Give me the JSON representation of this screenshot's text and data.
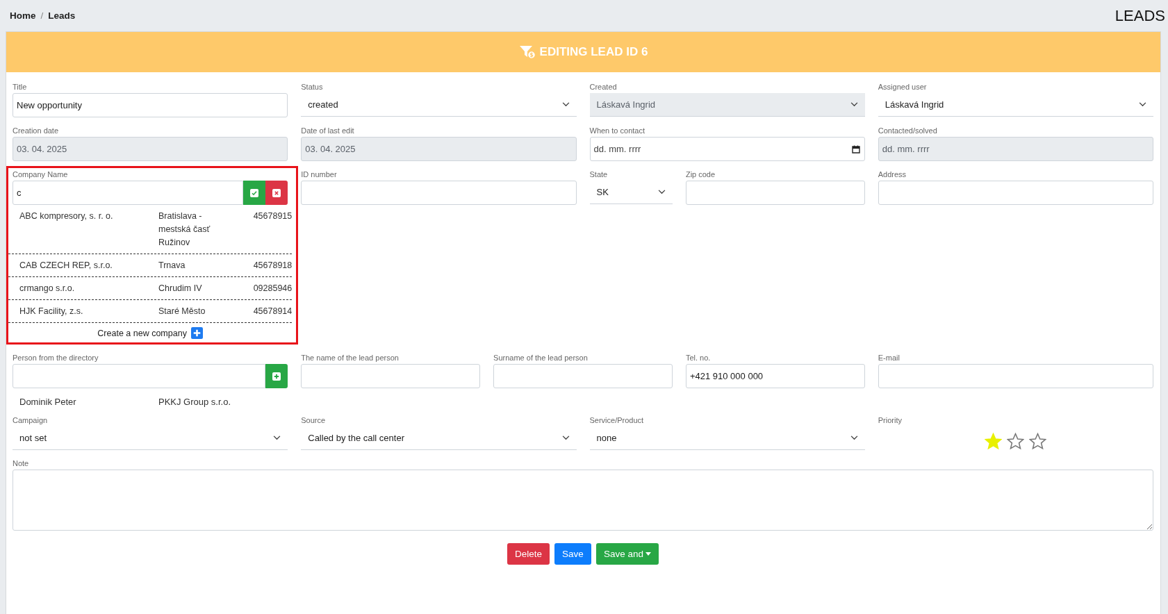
{
  "breadcrumb": {
    "items": [
      "Home",
      "Leads"
    ],
    "separator": "/"
  },
  "page_title": "LEADS",
  "header": {
    "title": "EDITING LEAD ID 6"
  },
  "rows": [
    {
      "fields": [
        {
          "label": "Title",
          "kind": "text",
          "value": "New opportunity",
          "disabled": false
        },
        {
          "label": "Status",
          "kind": "select",
          "value": "created",
          "disabled": false,
          "highlighted": false
        },
        {
          "label": "Created",
          "kind": "select",
          "value": "Láskavá Ingrid",
          "disabled": true,
          "highlighted": false
        },
        {
          "label": "Assigned user",
          "kind": "select",
          "value": "Láskavá Ingrid",
          "disabled": false,
          "highlighted": false
        }
      ]
    },
    {
      "fields": [
        {
          "label": "Creation date",
          "kind": "text",
          "value": "03. 04. 2025",
          "disabled": true,
          "highlighted": false
        },
        {
          "label": "Date of last edit",
          "kind": "text",
          "value": "03. 04. 2025",
          "disabled": true,
          "highlighted": false
        },
        {
          "label": "When to contact",
          "kind": "date",
          "placeholder": "dd. mm. rrrr",
          "disabled": false,
          "highlighted": false
        },
        {
          "label": "Contacted/solved",
          "kind": "text",
          "placeholder": "dd. mm. rrrr",
          "disabled": true,
          "highlighted": false
        }
      ]
    },
    {
      "fields": [
        {
          "label": "Company Name",
          "kind": "company_search",
          "value": "c",
          "disabled": false,
          "highlighted": true,
          "create_label": "Create a new company",
          "results": [
            {
              "name": "ABC kompresory, s. r. o.",
              "city": "Bratislava - mestská časť Ružinov",
              "id": "45678915"
            },
            {
              "name": "CAB CZECH REP, s.r.o.",
              "city": "Trnava",
              "id": "45678918"
            },
            {
              "name": "crmango s.r.o.",
              "city": "Chrudim IV",
              "id": "09285946"
            },
            {
              "name": "HJK Facility, z.s.",
              "city": "Staré Město",
              "id": "45678914"
            }
          ]
        },
        {
          "label": "ID number",
          "kind": "text",
          "disabled": false,
          "highlighted": false
        },
        {
          "label": "State",
          "kind": "select",
          "value": "SK",
          "disabled": false,
          "highlighted": false
        },
        {
          "label": "Zip code",
          "kind": "text",
          "disabled": false,
          "highlighted": false
        },
        {
          "label": "Address",
          "kind": "text",
          "disabled": false,
          "highlighted": false
        }
      ]
    },
    {
      "fields": [
        {
          "label": "Person from the directory",
          "kind": "person_search",
          "disabled": false,
          "highlighted": false,
          "results": [
            {
              "name": "Dominik Peter",
              "company": "PKKJ Group s.r.o."
            }
          ]
        },
        {
          "label": "The name of the lead person",
          "kind": "text",
          "disabled": false,
          "highlighted": false
        },
        {
          "label": "Surname of the lead person",
          "kind": "text",
          "disabled": false,
          "highlighted": false
        },
        {
          "label": "Tel. no.",
          "kind": "text",
          "value": "+421 910 000 000",
          "disabled": false,
          "highlighted": false
        },
        {
          "label": "E-mail",
          "kind": "text",
          "disabled": false,
          "highlighted": false
        }
      ]
    },
    {
      "fields": [
        {
          "label": "Campaign",
          "kind": "select",
          "value": "not set",
          "disabled": false,
          "highlighted": false
        },
        {
          "label": "Source",
          "kind": "select",
          "value": "Called by the call center",
          "disabled": false,
          "highlighted": false
        },
        {
          "label": "Service/Product",
          "kind": "select",
          "value": "none",
          "disabled": false,
          "highlighted": false
        },
        {
          "label": "Priority",
          "kind": "rating",
          "stars": 1,
          "highlighted": false
        }
      ]
    },
    {
      "fields": [
        {
          "label": "Note",
          "kind": "textarea",
          "disabled": false,
          "highlighted": false
        }
      ]
    }
  ],
  "buttons": [
    {
      "label": "Delete",
      "kind": "danger",
      "dropdown": false
    },
    {
      "label": "Save",
      "kind": "primary",
      "dropdown": false
    },
    {
      "label": "Save and",
      "kind": "success",
      "dropdown": true
    }
  ]
}
